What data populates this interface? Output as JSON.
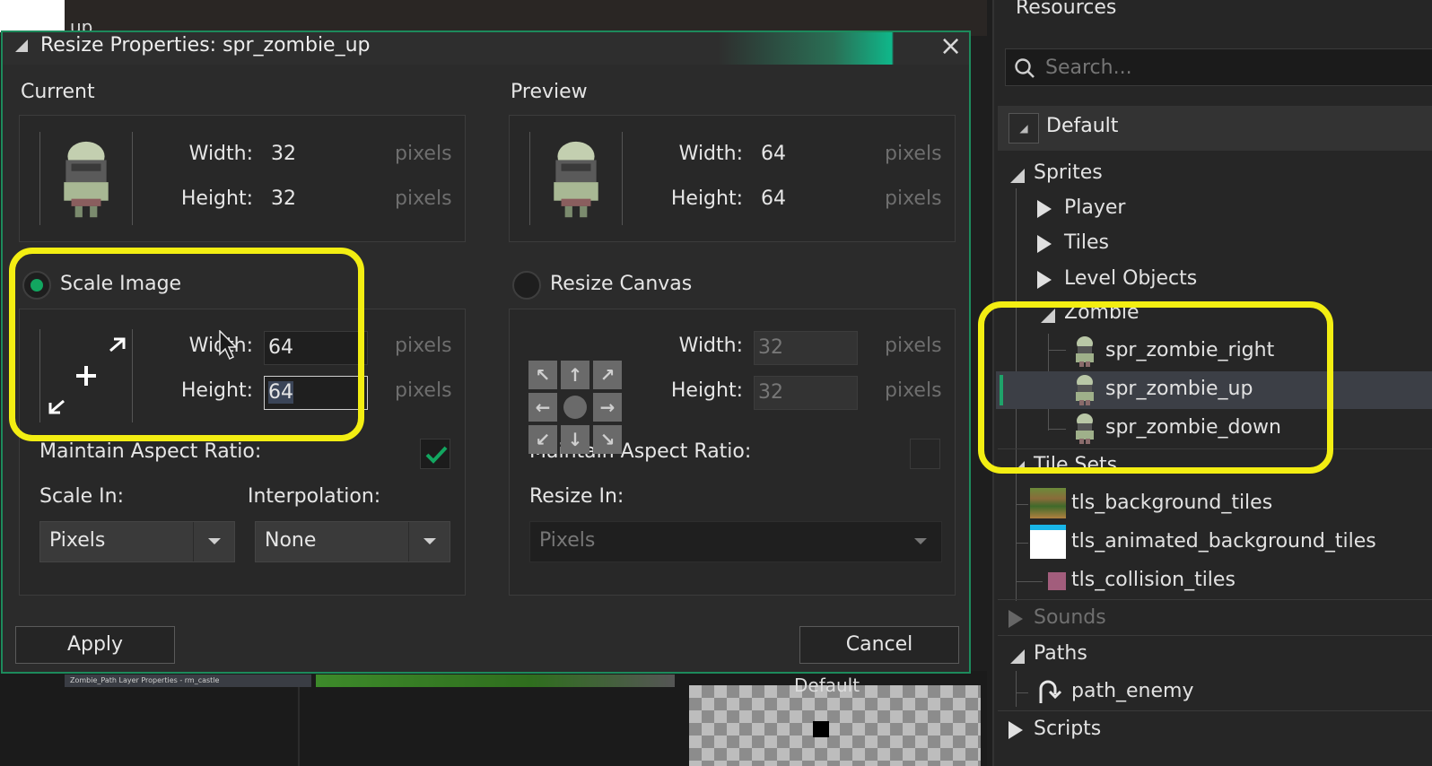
{
  "background": {
    "top_fragment": "up",
    "bottom_strip": "Zombie_Path Layer Properties - rm_castle",
    "bottom_default": "Default"
  },
  "dialog": {
    "title": "Resize Properties: spr_zombie_up",
    "close_icon": "×",
    "current": {
      "label": "Current",
      "width_label": "Width:",
      "width_value": "32",
      "height_label": "Height:",
      "height_value": "32",
      "unit": "pixels"
    },
    "preview": {
      "label": "Preview",
      "width_label": "Width:",
      "width_value": "64",
      "height_label": "Height:",
      "height_value": "64",
      "unit": "pixels"
    },
    "scale_image": {
      "label": "Scale Image",
      "selected": true,
      "width_label": "Width:",
      "width_value": "64",
      "height_label": "Height:",
      "height_value": "64",
      "unit": "pixels",
      "maintain_aspect_label": "Maintain Aspect Ratio:",
      "maintain_aspect_checked": true,
      "scale_in_label": "Scale In:",
      "scale_in_value": "Pixels",
      "interpolation_label": "Interpolation:",
      "interpolation_value": "None"
    },
    "resize_canvas": {
      "label": "Resize Canvas",
      "selected": false,
      "width_label": "Width:",
      "width_value": "32",
      "height_label": "Height:",
      "height_value": "32",
      "unit": "pixels",
      "maintain_aspect_label": "Maintain Aspect Ratio:",
      "maintain_aspect_checked": false,
      "resize_in_label": "Resize In:",
      "resize_in_value": "Pixels"
    },
    "apply_label": "Apply",
    "cancel_label": "Cancel"
  },
  "resources": {
    "title": "Resources",
    "search_placeholder": "Search...",
    "default_label": "Default",
    "tree": {
      "sprites": "Sprites",
      "player": "Player",
      "tiles": "Tiles",
      "level_objects": "Level Objects",
      "zombie": "Zombie",
      "spr_zombie_right": "spr_zombie_right",
      "spr_zombie_up": "spr_zombie_up",
      "spr_zombie_down": "spr_zombie_down",
      "tile_sets": "Tile Sets",
      "tls_background_tiles": "tls_background_tiles",
      "tls_animated_background_tiles": "tls_animated_background_tiles",
      "tls_collision_tiles": "tls_collision_tiles",
      "sounds": "Sounds",
      "paths": "Paths",
      "path_enemy": "path_enemy",
      "scripts": "Scripts"
    }
  },
  "colors": {
    "accent_green": "#12a660",
    "highlight_yellow": "#f3ee12",
    "titlebar_teal": "#0fb78a"
  }
}
